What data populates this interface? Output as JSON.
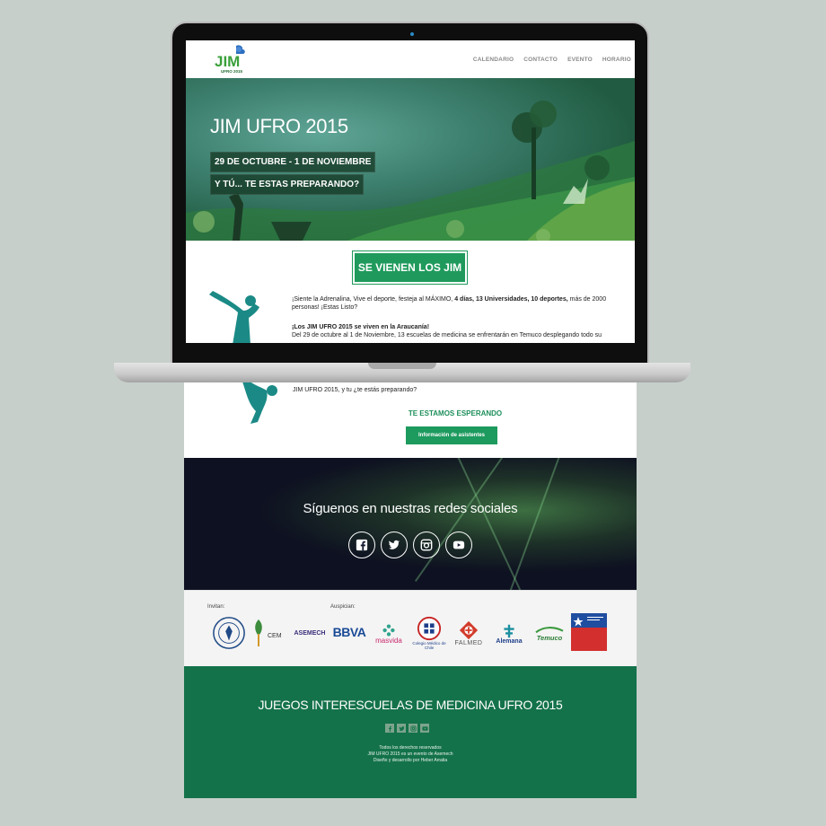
{
  "nav": {
    "logo_text": "JIM",
    "logo_sub": "UFRO 2015",
    "menu": [
      "CALENDARIO",
      "CONTACTO",
      "EVENTO",
      "HORARIO"
    ]
  },
  "hero": {
    "title": "JIM UFRO 2015",
    "dates": "29 DE OCTUBRE - 1 DE NOVIEMBRE",
    "tagline": "Y TÚ... TE ESTAS PREPARANDO?"
  },
  "main": {
    "cta_label": "SE VIENEN LOS JIM",
    "p1_start": "¡Siente la Adrenalina, Vive el deporte, festeja al MÁXIMO,",
    "p1_bold": "4 días, 13 Universidades, 10 deportes,",
    "p1_end": "más de 2000",
    "p1_line2": "personas! ¡Estas Listo?",
    "p2_title": "¡Los JIM UFRO 2015 se viven en la Araucanía!",
    "p2_body": "Del 29 de octubre al 1 de Noviembre, 13 escuelas de medicina se enfrentarán en Temuco desplegando todo su"
  },
  "continuation": {
    "text": "JIM UFRO 2015, y tu ¿te estás preparando?",
    "wait_title": "TE ESTAMOS ESPERANDO",
    "info_button": "Información de asistentes"
  },
  "social": {
    "title": "Síguenos en nuestras redes sociales",
    "icons": [
      "facebook-icon",
      "twitter-icon",
      "instagram-icon",
      "youtube-icon"
    ]
  },
  "sponsors": {
    "invite_label": "Invitan:",
    "sponsor_label": "Auspician:",
    "logos": [
      "CEM",
      "ASEMECH",
      "BBVA",
      "masvida",
      "Colegio Médico de Chile",
      "FALMED",
      "Alemana",
      "Temuco"
    ]
  },
  "footer": {
    "title": "JUEGOS INTERESCUELAS DE MEDICINA UFRO 2015",
    "line1": "Todos los derechos reservados",
    "line2": "JIM UFRO 2015 es un evento de Asemech",
    "line3": "Diseño y desarrollo por Heber Arratia"
  },
  "colors": {
    "brand_green": "#1f9a5c",
    "footer_green": "#14724a",
    "background": "#c7cfcb"
  }
}
